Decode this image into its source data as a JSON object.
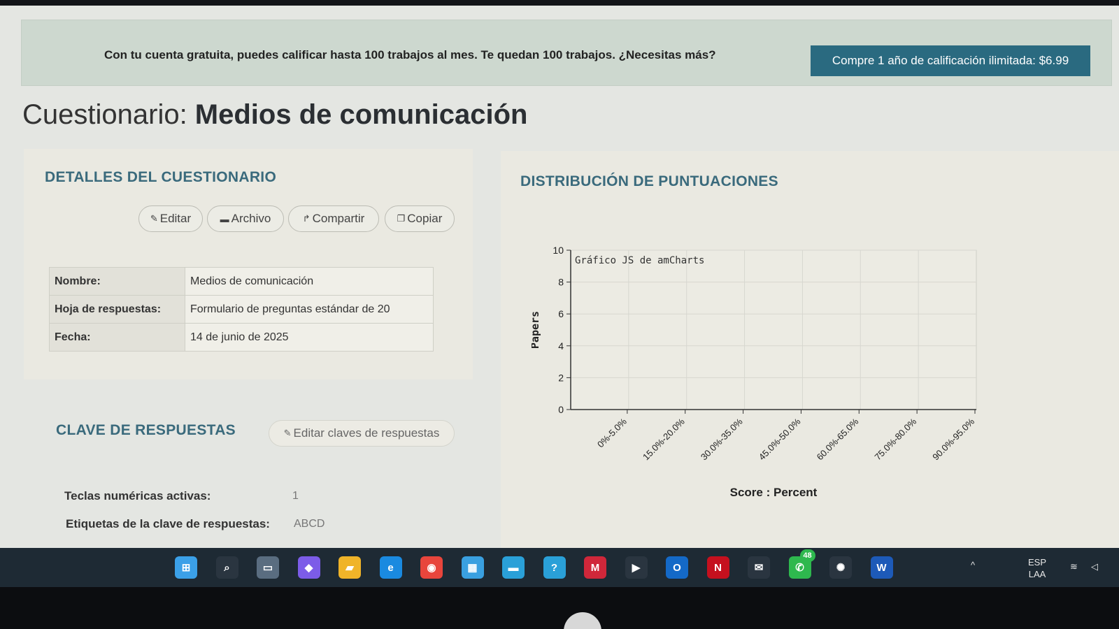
{
  "banner": {
    "text": "Con tu cuenta gratuita, puedes calificar hasta 100 trabajos al mes. Te quedan 100 trabajos. ¿Necesitas más?",
    "button": "Compre 1 año de calificación ilimitada: $6.99"
  },
  "page": {
    "title_prefix": "Cuestionario: ",
    "title_name": "Medios de comunicación"
  },
  "details": {
    "heading": "DETALLES DEL CUESTIONARIO",
    "actions": {
      "edit": "Editar",
      "archive": "Archivo",
      "share": "Compartir",
      "copy": "Copiar"
    },
    "rows": [
      {
        "label": "Nombre:",
        "value": "Medios de comunicación"
      },
      {
        "label": "Hoja de respuestas:",
        "value": "Formulario de preguntas estándar de 20"
      },
      {
        "label": "Fecha:",
        "value": "14 de junio de 2025"
      }
    ]
  },
  "answer_key": {
    "heading": "CLAVE DE RESPUESTAS",
    "edit_button": "Editar claves de respuestas",
    "numeric_keys_label": "Teclas numéricas activas:",
    "numeric_keys_value": "1",
    "labels_label": "Etiquetas de la clave de respuestas:",
    "labels_value": "ABCD"
  },
  "distribution": {
    "heading": "DISTRIBUCIÓN DE PUNTUACIONES"
  },
  "chart_data": {
    "type": "bar",
    "title": "",
    "watermark": "Gráfico JS de amCharts",
    "xlabel": "Score : Percent",
    "ylabel": "Papers",
    "categories": [
      "0%-5.0%",
      "15.0%-20.0%",
      "30.0%-35.0%",
      "45.0%-50.0%",
      "60.0%-65.0%",
      "75.0%-80.0%",
      "90.0%-95.0%"
    ],
    "values": [
      0,
      0,
      0,
      0,
      0,
      0,
      0
    ],
    "ylim": [
      0,
      10
    ],
    "yticks": [
      "0",
      "2",
      "4",
      "6",
      "8",
      "10"
    ],
    "grid": true,
    "colors": {
      "grid": "#d7d7d0",
      "axis": "#333333",
      "frame": "#cfcfc8"
    }
  },
  "taskbar": {
    "icons": [
      "windows-start-icon",
      "search-icon",
      "task-view-icon",
      "copilot-icon",
      "file-explorer-icon",
      "edge-icon",
      "chrome-icon",
      "store-icon",
      "app-icon",
      "help-icon",
      "mcafee-icon",
      "youtube-icon",
      "outlook-icon",
      "netflix-icon",
      "mail-icon",
      "whatsapp-icon",
      "chatgpt-icon",
      "word-icon"
    ],
    "whatsapp_badge": "48",
    "lang_line1": "ESP",
    "lang_line2": "LAA"
  }
}
